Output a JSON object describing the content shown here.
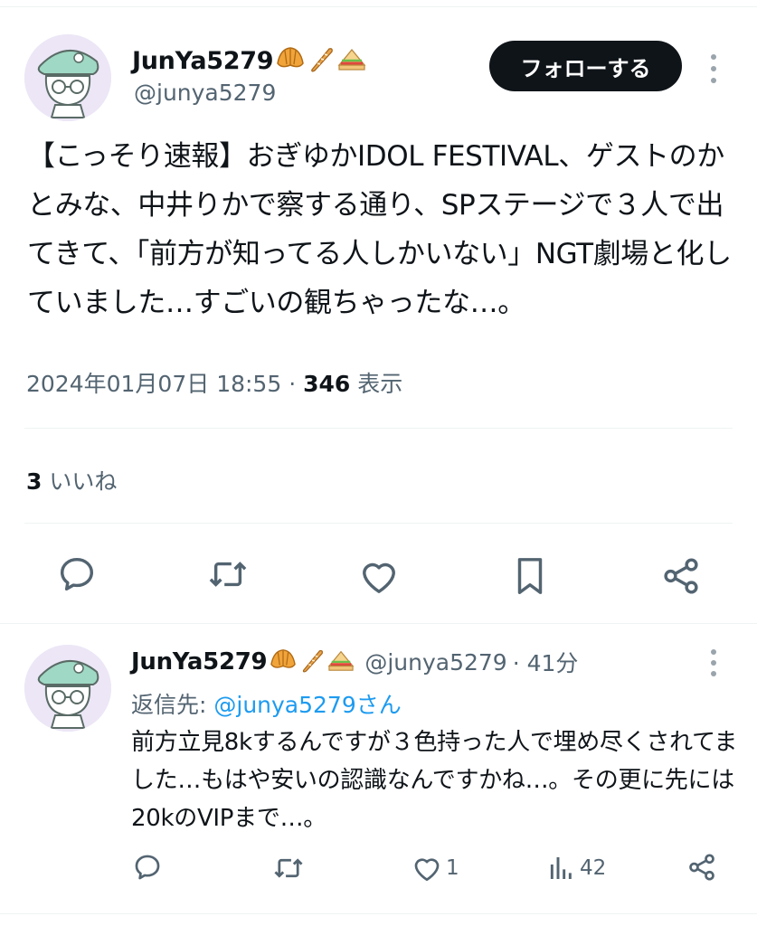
{
  "main_tweet": {
    "author": {
      "display_name": "JunYa5279",
      "handle": "@junya5279",
      "emojis": [
        "croissant-emoji",
        "baguette-emoji",
        "sandwich-emoji"
      ]
    },
    "follow_label": "フォローする",
    "text": "【こっそり速報】おぎゆかIDOL FESTIVAL、ゲストのかとみな、中井りかで察する通り、SPステージで３人で出てきて、「前方が知ってる人しかいない」NGT劇場と化していました…すごいの観ちゃったな…。",
    "timestamp": "2024年01月07日 18:55",
    "separator": " · ",
    "views_count": "346",
    "views_label": "表示",
    "likes_count": "3",
    "likes_label": "いいね",
    "actions": [
      "reply-icon",
      "retweet-icon",
      "like-icon",
      "bookmark-icon",
      "share-icon"
    ]
  },
  "reply_tweet": {
    "author": {
      "display_name": "JunYa5279",
      "handle": "@junya5279",
      "time": "· 41分"
    },
    "reply_to_label": "返信先: ",
    "reply_to_handle": "@junya5279さん",
    "text": "前方立見8kするんですが３色持った人で埋め尽くされてました…もはや安いの認識なんですかね…。その更に先には20kのVIPまで…。",
    "like_count": "1",
    "views_count": "42"
  },
  "colors": {
    "text_primary": "#0f1419",
    "text_secondary": "#536471",
    "link": "#1d9bf0",
    "border": "#eff3f4",
    "follow_bg": "#0f1419"
  }
}
